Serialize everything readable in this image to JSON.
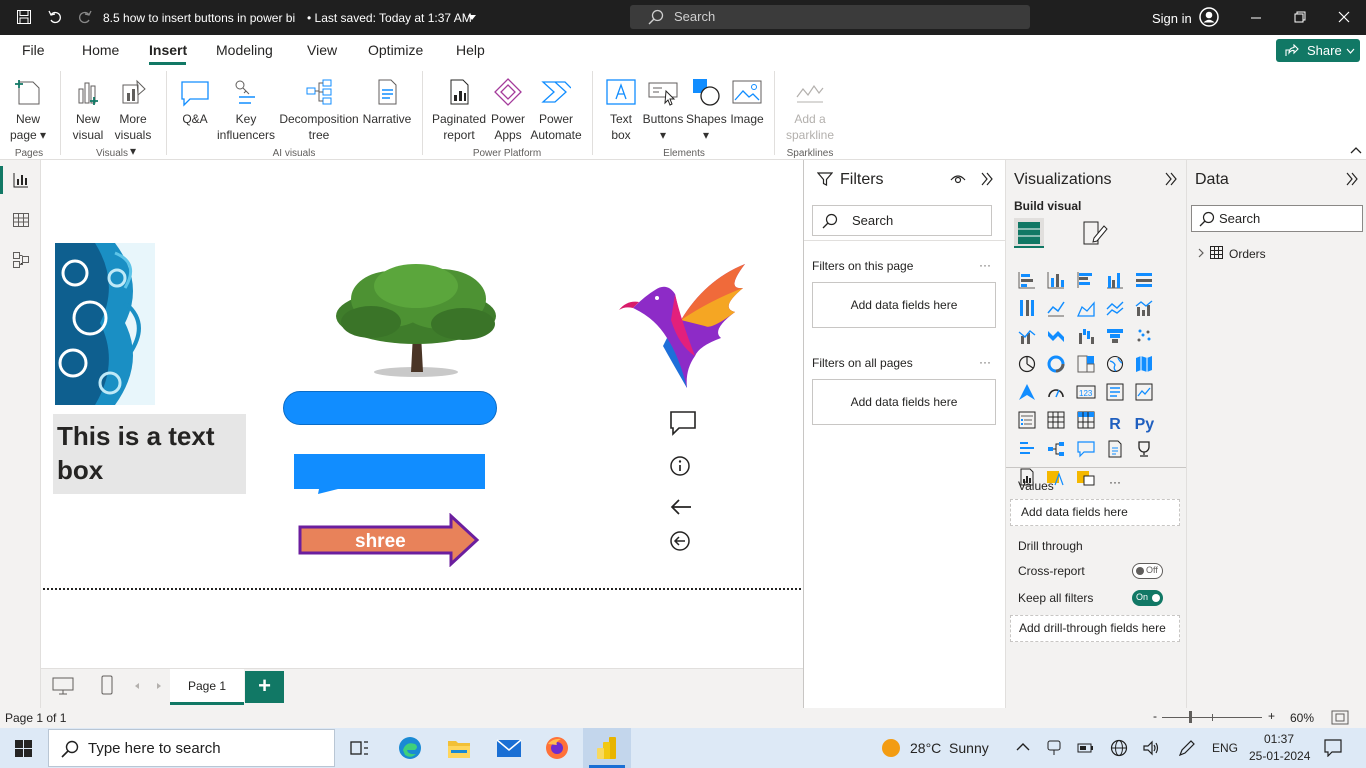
{
  "titlebar": {
    "filename": "8.5 how to insert buttons in power bi",
    "saved": "• Last saved: Today at 1:37 AM",
    "search_placeholder": "Search",
    "signin": "Sign in"
  },
  "menu": {
    "items": [
      "File",
      "Home",
      "Insert",
      "Modeling",
      "View",
      "Optimize",
      "Help"
    ],
    "active": "Insert",
    "share": "Share"
  },
  "ribbon": {
    "buttons": [
      {
        "label1": "New",
        "label2": "page ▾"
      },
      {
        "label1": "New",
        "label2": "visual"
      },
      {
        "label1": "More",
        "label2": "visuals ▾"
      },
      {
        "label1": "Q&A",
        "label2": ""
      },
      {
        "label1": "Key",
        "label2": "influencers"
      },
      {
        "label1": "Decomposition",
        "label2": "tree"
      },
      {
        "label1": "Narrative",
        "label2": ""
      },
      {
        "label1": "Paginated",
        "label2": "report"
      },
      {
        "label1": "Power",
        "label2": "Apps"
      },
      {
        "label1": "Power",
        "label2": "Automate"
      },
      {
        "label1": "Text",
        "label2": "box"
      },
      {
        "label1": "Buttons",
        "label2": "▾"
      },
      {
        "label1": "Shapes",
        "label2": "▾"
      },
      {
        "label1": "Image",
        "label2": ""
      },
      {
        "label1": "Add a",
        "label2": "sparkline"
      }
    ],
    "groups": [
      "Pages",
      "Visuals",
      "AI visuals",
      "Power Platform",
      "Elements",
      "Sparklines"
    ]
  },
  "canvas": {
    "textbox": "This is a text box",
    "arrow_text": "shree"
  },
  "pagebar": {
    "tab": "Page 1",
    "add": "+"
  },
  "status": {
    "page": "Page 1 of 1",
    "zoom": "60%",
    "zoom_minus": "-",
    "zoom_plus": "+"
  },
  "filters": {
    "title": "Filters",
    "search": "Search",
    "on_page": "Filters on this page",
    "all_pages": "Filters on all pages",
    "add": "Add data fields here",
    "more": "···"
  },
  "viz": {
    "title": "Visualizations",
    "build": "Build visual",
    "values": "Values",
    "add": "Add data fields here",
    "drill": "Drill through",
    "cross": "Cross-report",
    "cross_state": "Off",
    "keep": "Keep all filters",
    "keep_state": "On",
    "add_drill": "Add drill-through fields here",
    "r_label": "R",
    "py_label": "Py",
    "more": "···"
  },
  "data": {
    "title": "Data",
    "search": "Search",
    "table": "Orders"
  },
  "taskbar": {
    "search": "Type here to search",
    "weather": "28°C  Sunny",
    "lang": "ENG",
    "time": "01:37",
    "date": "25-01-2024"
  },
  "colors": {
    "accent": "#117865",
    "blue": "#118dff",
    "arrow": "#e8825a",
    "arrow_border": "#6b1e9e"
  }
}
